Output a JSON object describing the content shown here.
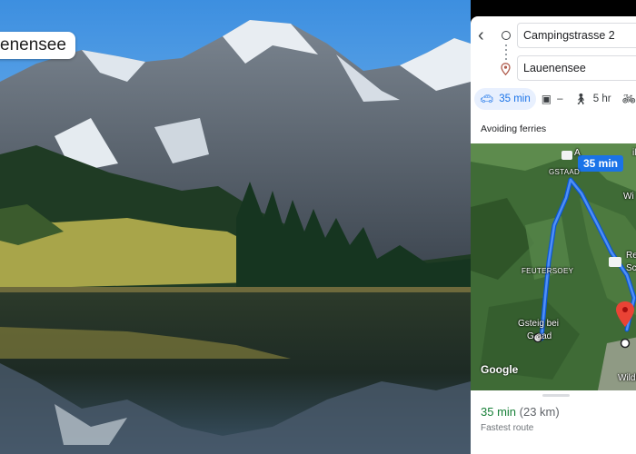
{
  "photo": {
    "location_label": "enensee"
  },
  "directions": {
    "origin": "Campingstrasse 2",
    "destination": "Lauenensee",
    "modes": [
      {
        "icon": "car-icon",
        "label": "35 min",
        "active": true
      },
      {
        "icon": "train-icon",
        "label": "–",
        "active": false
      },
      {
        "icon": "walk-icon",
        "label": "5 hr",
        "active": false
      },
      {
        "icon": "bike-icon",
        "label": "",
        "active": false
      }
    ],
    "notice": "Avoiding ferries"
  },
  "map": {
    "time_bubble": "35 min",
    "labels": {
      "gstaad": "GSTAAD",
      "feutersoey": "FEUTERSOEY",
      "gsteig_line1": "Gsteig bei",
      "gsteig_line2": "G   aad",
      "lauenen_fragment_1": "Re",
      "lauenen_fragment_2": "Sc",
      "top_fragment": "A",
      "top_right_fragment": "illi",
      "right_fragment": "Wi",
      "wildhorn_fragment": "Wildho"
    },
    "logo": "Google"
  },
  "summary": {
    "time": "35 min",
    "distance": "(23 km)",
    "subtitle": "Fastest route"
  },
  "colors": {
    "route": "#1a73e8",
    "accent": "#1a73e8",
    "pin": "#ea4335",
    "time_green": "#188038"
  }
}
